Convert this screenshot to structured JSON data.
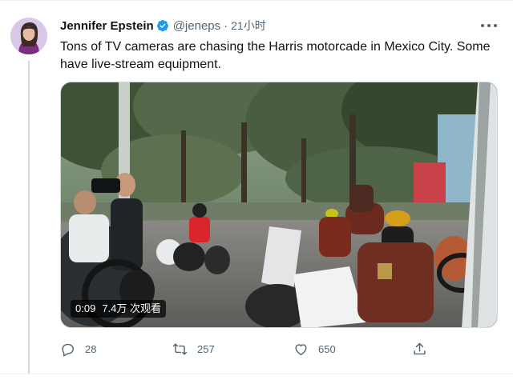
{
  "tweet": {
    "author_name": "Jennifer Epstein",
    "handle": "@jeneps",
    "separator": "·",
    "time": "21小时",
    "text": "Tons of TV cameras are chasing the Harris motorcade in Mexico City. Some have live-stream equipment."
  },
  "video": {
    "duration": "0:09",
    "views": "7.4万 次观看"
  },
  "actions": {
    "reply_count": "28",
    "retweet_count": "257",
    "like_count": "650"
  },
  "icons": {
    "verified": "verified-badge-icon",
    "more": "more-icon",
    "reply": "reply-icon",
    "retweet": "retweet-icon",
    "like": "like-icon",
    "share": "share-icon"
  },
  "colors": {
    "verified": "#1d9bf0",
    "secondary_text": "#536471",
    "primary_text": "#0f1419",
    "divider": "#cfd9de"
  }
}
